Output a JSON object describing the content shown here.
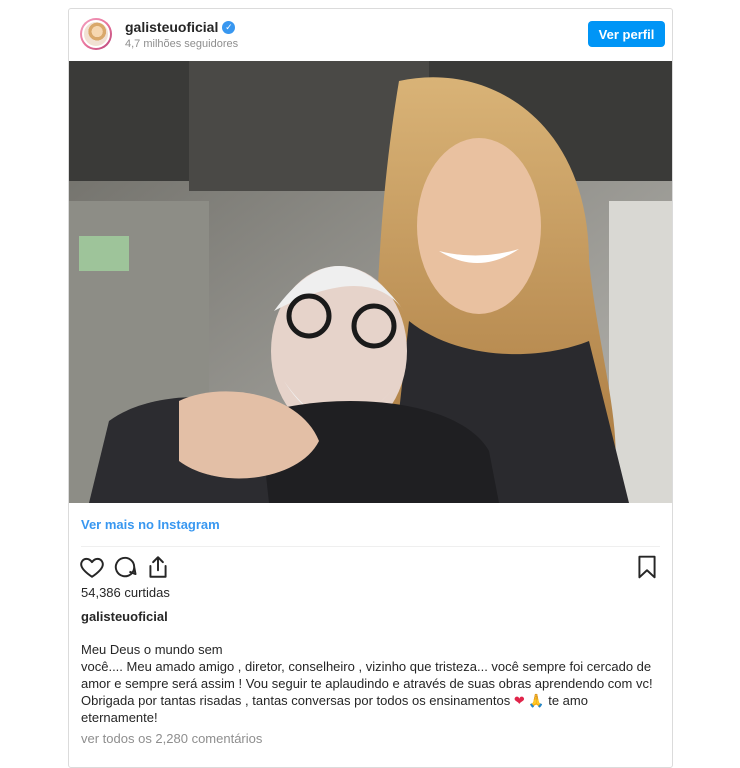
{
  "post": {
    "username": "galisteuoficial",
    "verified_mark": "✓",
    "followers": "4,7 milhões seguidores",
    "profile_button": "Ver perfil",
    "photo_alt": "",
    "more_link": "Ver mais no Instagram",
    "likes": "54,386 curtidas",
    "caption_username": "galisteuoficial",
    "caption_lines": [
      "Meu Deus o mundo sem",
      "você.... Meu amado amigo , diretor, conselheiro , vizinho que tristeza... você sempre foi cercado de",
      "amor e sempre será assim ! Vou seguir te aplaudindo e através de suas obras aprendendo com vc!",
      "Obrigada por tantas risadas , tantas conversas por todos os ensinamentos",
      "eternamente!"
    ],
    "caption_line4_emoji_heart": "❤",
    "caption_line4_emoji_pray": "🙏",
    "caption_line4_tail": "te amo",
    "comments_link": "ver todos os 2,280 comentários"
  },
  "icons": {
    "like": "heart-outline-icon",
    "comment": "speech-bubble-icon",
    "share": "share-upload-icon",
    "save": "bookmark-icon"
  },
  "colors": {
    "link_blue": "#3897f0",
    "button_blue": "#0095f6",
    "text": "#262626",
    "muted": "#8e8e8e",
    "border": "#dbdbdb"
  }
}
